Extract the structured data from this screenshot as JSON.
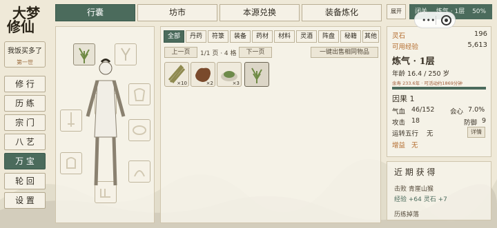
{
  "app": {
    "logo_line1": "大梦",
    "logo_line2": "修仙"
  },
  "player": {
    "name": "我饭买多了",
    "generation": "第一世"
  },
  "nav": [
    {
      "label": "修 行",
      "active": false
    },
    {
      "label": "历 练",
      "active": false
    },
    {
      "label": "宗 门",
      "active": false
    },
    {
      "label": "八 艺",
      "active": false
    },
    {
      "label": "万 宝",
      "active": true
    },
    {
      "label": "轮 回",
      "active": false
    },
    {
      "label": "设 置",
      "active": false
    }
  ],
  "tabs": [
    {
      "label": "行囊",
      "active": true
    },
    {
      "label": "坊市",
      "active": false
    },
    {
      "label": "本源兑换",
      "active": false
    },
    {
      "label": "装备炼化",
      "active": false
    }
  ],
  "header": {
    "expand_label": "展开",
    "close_label": "闭关",
    "realm_chip": "炼气 · 1层",
    "progress_percent": "50%"
  },
  "categories": [
    "全部",
    "丹药",
    "符箓",
    "装备",
    "药材",
    "材料",
    "灵酒",
    "阵盘",
    "秘籍",
    "其他"
  ],
  "inventory": {
    "prev_label": "上一页",
    "next_label": "下一页",
    "page_info": "1/1 页 · 4 格",
    "sell_all_label": "一键出售相同物品",
    "items": [
      {
        "icon": "bamboo-bundle-icon",
        "qty": "×10"
      },
      {
        "icon": "animal-pelt-icon",
        "qty": "×2"
      },
      {
        "icon": "herb-plate-icon",
        "qty": "×3"
      },
      {
        "icon": "grass-sprout-icon",
        "qty": ""
      }
    ]
  },
  "stats": {
    "spirit_stone_label": "灵石",
    "spirit_stone": "196",
    "exp_label": "可用经验",
    "exp": "5,613",
    "realm": "炼气 · 1层",
    "age_text": "年龄 16.4 / 250 岁",
    "remaining_text": "余寿 233.6年 · 可活动约1869分钟",
    "karma_text": "因果 1",
    "hp_label": "气血",
    "hp": "46/152",
    "crit_label": "会心",
    "crit": "7.0%",
    "atk_label": "攻击",
    "atk": "18",
    "def_label": "防御",
    "def": "9",
    "luck_label": "运转五行",
    "luck": "无",
    "detail_label": "详情",
    "bonus_label": "增益",
    "bonus": "无"
  },
  "recent": {
    "title": "近 期 获 得",
    "line1": "击败 青崖山猴",
    "line2": "经验 +64 灵石 +7",
    "line3": "历练掉落"
  },
  "colors": {
    "accent": "#4b6b5c",
    "paper": "#efe9d8",
    "gold": "#b36b2c"
  }
}
